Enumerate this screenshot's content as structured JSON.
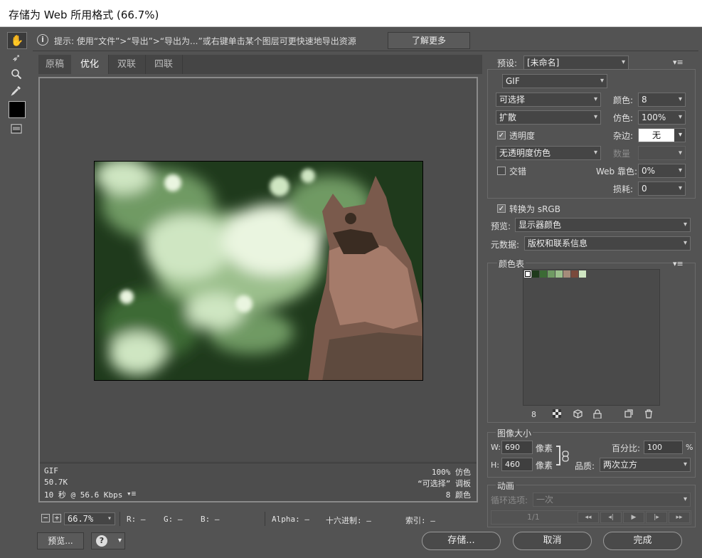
{
  "window": {
    "title": "存储为 Web 所用格式 (66.7%)"
  },
  "hint": {
    "text": "提示: 使用“文件”>“导出”>“导出为...”或右键单击某个图层可更快速地导出资源",
    "learn_more": "了解更多"
  },
  "tabs": [
    "原稿",
    "优化",
    "双联",
    "四联"
  ],
  "info": {
    "format": "GIF",
    "size": "50.7K",
    "time": "10 秒 @ 56.6 Kbps",
    "dither": "100% 仿色",
    "palette": "“可选择” 调板",
    "colors": "8 颜色"
  },
  "status": {
    "zoom": "66.7%",
    "r": "R: —",
    "g": "G: —",
    "b": "B: —",
    "alpha": "Alpha: —",
    "hex": "十六进制: —",
    "index": "索引: —"
  },
  "buttons": {
    "preview": "预览...",
    "save": "存储...",
    "cancel": "取消",
    "done": "完成"
  },
  "settings": {
    "preset_label": "预设:",
    "preset_value": "[未命名]",
    "format": "GIF",
    "reduction": "可选择",
    "colors_label": "颜色:",
    "colors_value": "8",
    "dither_algo": "扩散",
    "dither_label": "仿色:",
    "dither_value": "100%",
    "transparency_label": "透明度",
    "matte_label": "杂边:",
    "matte_value": "无",
    "trans_dither": "无透明度仿色",
    "amount_label": "数量",
    "interlace_label": "交错",
    "websnap_label": "Web 靠色:",
    "websnap_value": "0%",
    "lossy_label": "损耗:",
    "lossy_value": "0",
    "convert_label": "转换为 sRGB",
    "preview_label": "预览:",
    "preview_value": "显示器颜色",
    "metadata_label": "元数据:",
    "metadata_value": "版权和联系信息"
  },
  "color_table": {
    "title": "颜色表",
    "count": "8",
    "colors": [
      "#ffffff",
      "#1f3a1c",
      "#3c6a35",
      "#6f9a63",
      "#9bbf8c",
      "#a58b7a",
      "#7a4a3c",
      "#cfe6c2"
    ]
  },
  "image_size": {
    "title": "图像大小",
    "w_label": "W:",
    "w_value": "690",
    "h_label": "H:",
    "h_value": "460",
    "unit": "像素",
    "percent_label": "百分比:",
    "percent_value": "100",
    "percent_unit": "%",
    "quality_label": "品质:",
    "quality_value": "两次立方"
  },
  "animation": {
    "title": "动画",
    "loop_label": "循环选项:",
    "loop_value": "一次",
    "frame": "1/1"
  }
}
